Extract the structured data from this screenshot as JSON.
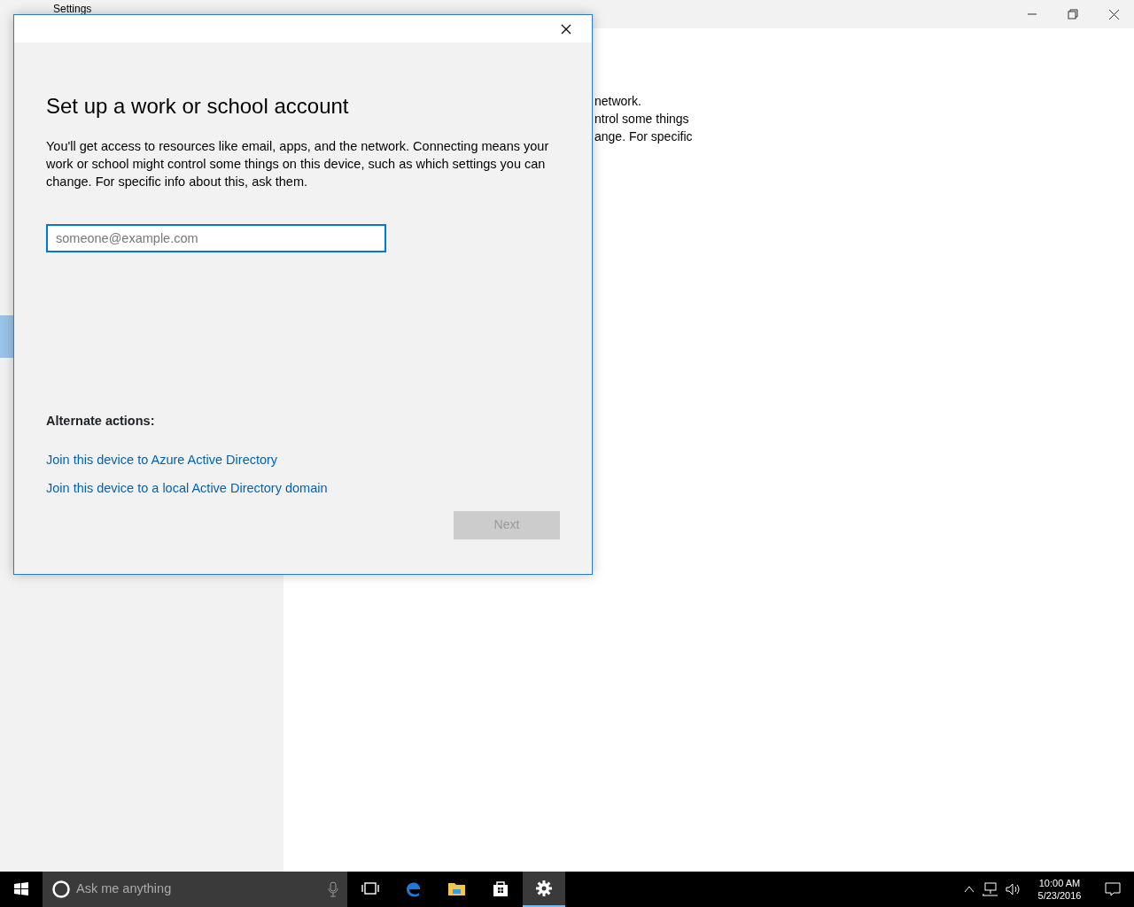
{
  "background_window": {
    "title": "Settings",
    "sidebar": {
      "items": [
        {
          "selected": false
        },
        {
          "selected": false
        },
        {
          "selected": false
        },
        {
          "selected": false
        },
        {
          "selected": false
        },
        {
          "selected": true
        },
        {
          "selected": false
        },
        {
          "selected": false
        }
      ]
    },
    "content_lines": [
      "network.",
      "ntrol some things",
      "ange. For specific"
    ]
  },
  "dialog": {
    "heading": "Set up a work or school account",
    "description": "You'll get access to resources like email, apps, and the network. Connecting means your work or school might control some things on this device, such as which settings you can change. For specific info about this, ask them.",
    "email_field": {
      "placeholder": "someone@example.com",
      "focused": true
    },
    "alternate_actions_label": "Alternate actions:",
    "links": [
      "Join this device to Azure Active Directory",
      "Join this device to a local Active Directory domain"
    ],
    "next_button": {
      "label": "Next",
      "disabled": true
    }
  },
  "taskbar": {
    "search_placeholder": "Ask me anything",
    "apps": [
      {
        "kind": "task-view",
        "selected": false
      },
      {
        "kind": "edge",
        "selected": false
      },
      {
        "kind": "explorer",
        "selected": false
      },
      {
        "kind": "store",
        "selected": false
      },
      {
        "kind": "settings",
        "selected": true
      }
    ],
    "clock": {
      "time": "10:00 AM",
      "date": "5/23/2016"
    }
  }
}
